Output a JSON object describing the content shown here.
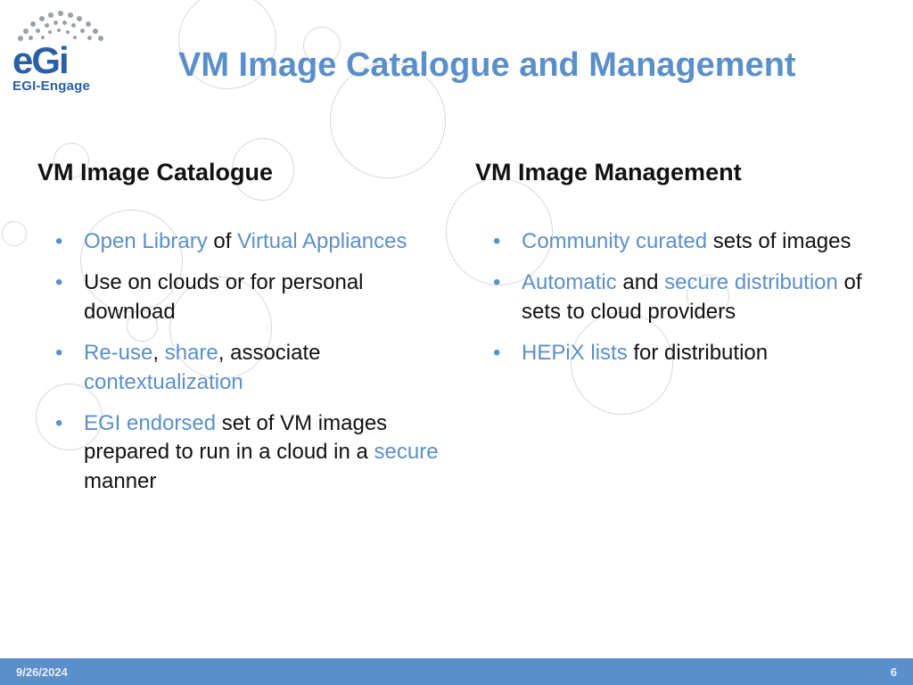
{
  "brand": {
    "name": "eGi",
    "sub": "EGI-Engage"
  },
  "title": "VM Image Catalogue and Management",
  "left": {
    "heading": "VM Image Catalogue",
    "b1": {
      "a": "Open Library",
      "b": " of ",
      "c": "Virtual Appliances"
    },
    "b2": "Use on clouds or for personal download",
    "b3": {
      "a": "Re-use",
      "b": ", ",
      "c": "share",
      "d": ", associate ",
      "e": "contextualization"
    },
    "b4": {
      "a": "EGI endorsed",
      "b": " set of VM images prepared to run in a cloud in a ",
      "c": "secure",
      "d": " manner"
    }
  },
  "right": {
    "heading": "VM Image Management",
    "b1": {
      "a": "Community curated",
      "b": " sets of images"
    },
    "b2": {
      "a": "Automatic",
      "b": " and ",
      "c": "secure distribution",
      "d": " of sets to cloud providers"
    },
    "b3": {
      "a": "HEPiX lists",
      "b": " for distribution"
    }
  },
  "footer": {
    "date": "9/26/2024",
    "page": "6"
  }
}
